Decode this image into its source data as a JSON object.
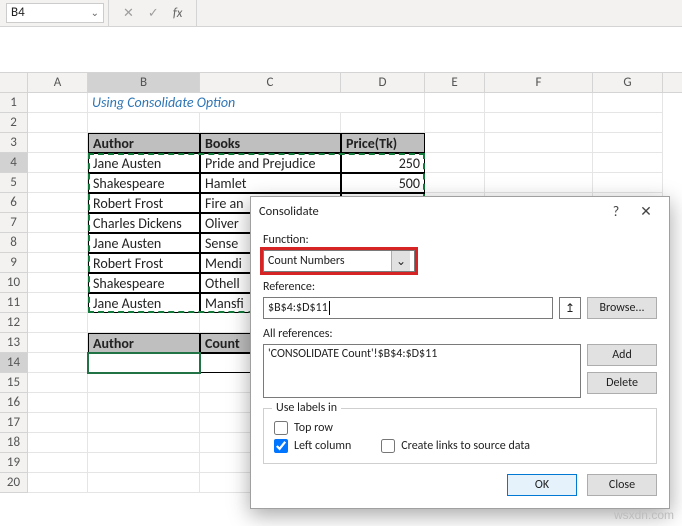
{
  "nameBox": "B4",
  "fxSymbols": {
    "cancel": "✕",
    "accept": "✓",
    "fx": "fx"
  },
  "colHeaders": [
    "A",
    "B",
    "C",
    "D",
    "E",
    "F",
    "G"
  ],
  "rowHeaders": [
    "1",
    "2",
    "3",
    "4",
    "5",
    "6",
    "7",
    "8",
    "9",
    "10",
    "11",
    "12",
    "13",
    "14",
    "15",
    "16",
    "17",
    "18",
    "19",
    "20"
  ],
  "title": "Using Consolidate Option",
  "table": {
    "headers": {
      "author": "Author",
      "books": "Books",
      "price": "Price(Tk)"
    },
    "rows": [
      {
        "author": "Jane Austen",
        "book": "Pride and Prejudice",
        "price": "250"
      },
      {
        "author": "Shakespeare",
        "book": "Hamlet",
        "price": "500"
      },
      {
        "author": "Robert Frost",
        "book": "Fire an",
        "price": ""
      },
      {
        "author": "Charles Dickens",
        "book": "Oliver",
        "price": ""
      },
      {
        "author": "Jane Austen",
        "book": "Sense",
        "price": ""
      },
      {
        "author": "Robert Frost",
        "book": "Mendi",
        "price": ""
      },
      {
        "author": "Shakespeare",
        "book": "Othell",
        "price": ""
      },
      {
        "author": "Jane Austen",
        "book": "Mansfi",
        "price": ""
      }
    ]
  },
  "table2": {
    "headers": {
      "author": "Author",
      "count": "Count"
    }
  },
  "dialog": {
    "title": "Consolidate",
    "help": "?",
    "close": "✕",
    "functionLabel": "Function:",
    "functionValue": "Count Numbers",
    "referenceLabel": "Reference:",
    "referenceValue": "$B$4:$D$11",
    "allRefsLabel": "All references:",
    "allRefs": "'CONSOLIDATE Count'!$B$4:$D$11",
    "browse": "Browse...",
    "add": "Add",
    "delete": "Delete",
    "groupTitle": "Use labels in",
    "topRow": "Top row",
    "leftCol": "Left column",
    "createLinks": "Create links to source data",
    "ok": "OK",
    "closeBtn": "Close",
    "dropdownGlyph": "⌄",
    "refPickGlyph": "↥"
  },
  "watermark": "wsxdn.com"
}
